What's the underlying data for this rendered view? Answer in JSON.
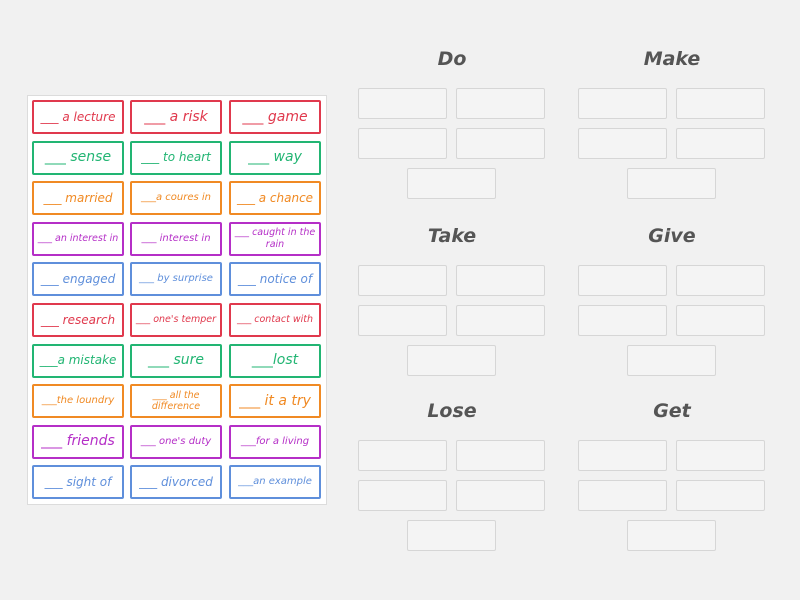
{
  "palette": {
    "red": "#e0394d",
    "green": "#22b573",
    "orange": "#f08a24",
    "purple": "#b52fc7",
    "blue": "#5f8fdb"
  },
  "cards": [
    [
      {
        "text": "___ a lecture",
        "color": "red",
        "size": "md"
      },
      {
        "text": "___ a risk",
        "color": "red",
        "size": "lg"
      },
      {
        "text": "___ game",
        "color": "red",
        "size": "lg"
      }
    ],
    [
      {
        "text": "___ sense",
        "color": "green",
        "size": "lg"
      },
      {
        "text": "___ to heart",
        "color": "green",
        "size": "md"
      },
      {
        "text": "___ way",
        "color": "green",
        "size": "lg"
      }
    ],
    [
      {
        "text": "___ married",
        "color": "orange",
        "size": "md"
      },
      {
        "text": "___a coures in",
        "color": "orange",
        "size": "sm"
      },
      {
        "text": "___ a chance",
        "color": "orange",
        "size": "md"
      }
    ],
    [
      {
        "text": "___ an interest in",
        "color": "purple",
        "size": "xs"
      },
      {
        "text": "___ interest in",
        "color": "purple",
        "size": "sm"
      },
      {
        "text": "___ caught in the rain",
        "color": "purple",
        "size": "xs"
      }
    ],
    [
      {
        "text": "___ engaged",
        "color": "blue",
        "size": "md"
      },
      {
        "text": "___ by surprise",
        "color": "blue",
        "size": "sm"
      },
      {
        "text": "___ notice of",
        "color": "blue",
        "size": "md"
      }
    ],
    [
      {
        "text": "___ research",
        "color": "red",
        "size": "md"
      },
      {
        "text": "___ one's temper",
        "color": "red",
        "size": "xs"
      },
      {
        "text": "___ contact with",
        "color": "red",
        "size": "xs"
      }
    ],
    [
      {
        "text": "___a mistake",
        "color": "green",
        "size": "md"
      },
      {
        "text": "___ sure",
        "color": "green",
        "size": "lg"
      },
      {
        "text": "___lost",
        "color": "green",
        "size": "lg"
      }
    ],
    [
      {
        "text": "___the loundry",
        "color": "orange",
        "size": "sm"
      },
      {
        "text": "___ all the difference",
        "color": "orange",
        "size": "xs"
      },
      {
        "text": "___ it a try",
        "color": "orange",
        "size": "lg"
      }
    ],
    [
      {
        "text": "___ friends",
        "color": "purple",
        "size": "lg"
      },
      {
        "text": "___ one's duty",
        "color": "purple",
        "size": "sm"
      },
      {
        "text": "___for a living",
        "color": "purple",
        "size": "sm"
      }
    ],
    [
      {
        "text": "___ sight of",
        "color": "blue",
        "size": "md"
      },
      {
        "text": "___ divorced",
        "color": "blue",
        "size": "md"
      },
      {
        "text": "___an example",
        "color": "blue",
        "size": "sm"
      }
    ]
  ],
  "groups": [
    {
      "title": "Do",
      "slots": 5
    },
    {
      "title": "Make",
      "slots": 5
    },
    {
      "title": "Take",
      "slots": 5
    },
    {
      "title": "Give",
      "slots": 5
    },
    {
      "title": "Lose",
      "slots": 5
    },
    {
      "title": "Get",
      "slots": 5
    }
  ]
}
